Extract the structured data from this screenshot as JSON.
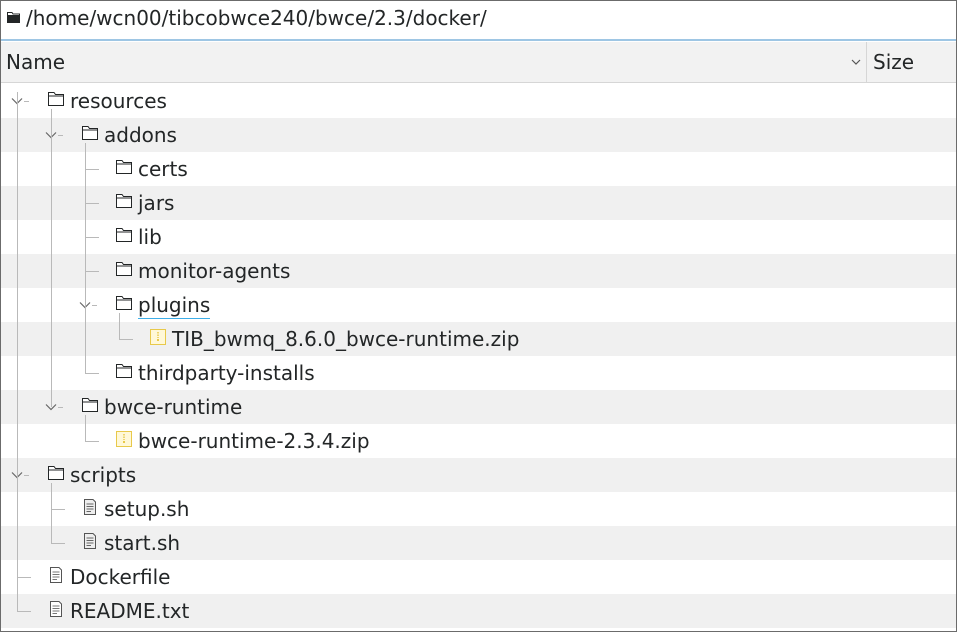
{
  "window": {
    "path": "/home/wcn00/tibcobwce240/bwce/2.3/docker/"
  },
  "header": {
    "name_label": "Name",
    "size_label": "Size"
  },
  "tree": [
    {
      "label": "resources",
      "icon": "folder-icon",
      "depth": 0,
      "expanded": true
    },
    {
      "label": "addons",
      "icon": "folder-icon",
      "depth": 1,
      "expanded": true
    },
    {
      "label": "certs",
      "icon": "folder-icon",
      "depth": 2
    },
    {
      "label": "jars",
      "icon": "folder-icon",
      "depth": 2
    },
    {
      "label": "lib",
      "icon": "folder-icon",
      "depth": 2
    },
    {
      "label": "monitor-agents",
      "icon": "folder-icon",
      "depth": 2
    },
    {
      "label": "plugins",
      "icon": "folder-icon",
      "depth": 2,
      "expanded": true,
      "focused": true
    },
    {
      "label": "TIB_bwmq_8.6.0_bwce-runtime.zip",
      "icon": "archive-icon",
      "depth": 3
    },
    {
      "label": "thirdparty-installs",
      "icon": "folder-icon",
      "depth": 2
    },
    {
      "label": "bwce-runtime",
      "icon": "folder-icon",
      "depth": 1,
      "expanded": true
    },
    {
      "label": "bwce-runtime-2.3.4.zip",
      "icon": "archive-icon",
      "depth": 2
    },
    {
      "label": "scripts",
      "icon": "folder-icon",
      "depth": 0,
      "expanded": true
    },
    {
      "label": "setup.sh",
      "icon": "script-file-icon",
      "depth": 1
    },
    {
      "label": "start.sh",
      "icon": "script-file-icon",
      "depth": 1
    },
    {
      "label": "Dockerfile",
      "icon": "text-file-icon",
      "depth": 0
    },
    {
      "label": "README.txt",
      "icon": "text-file-icon",
      "depth": 0
    }
  ],
  "colors": {
    "alternate_row": "#f0f0f0",
    "focus_underline": "#3daee9",
    "archive_icon": "#e8c94a",
    "tree_lines": "#b9b9b9"
  }
}
